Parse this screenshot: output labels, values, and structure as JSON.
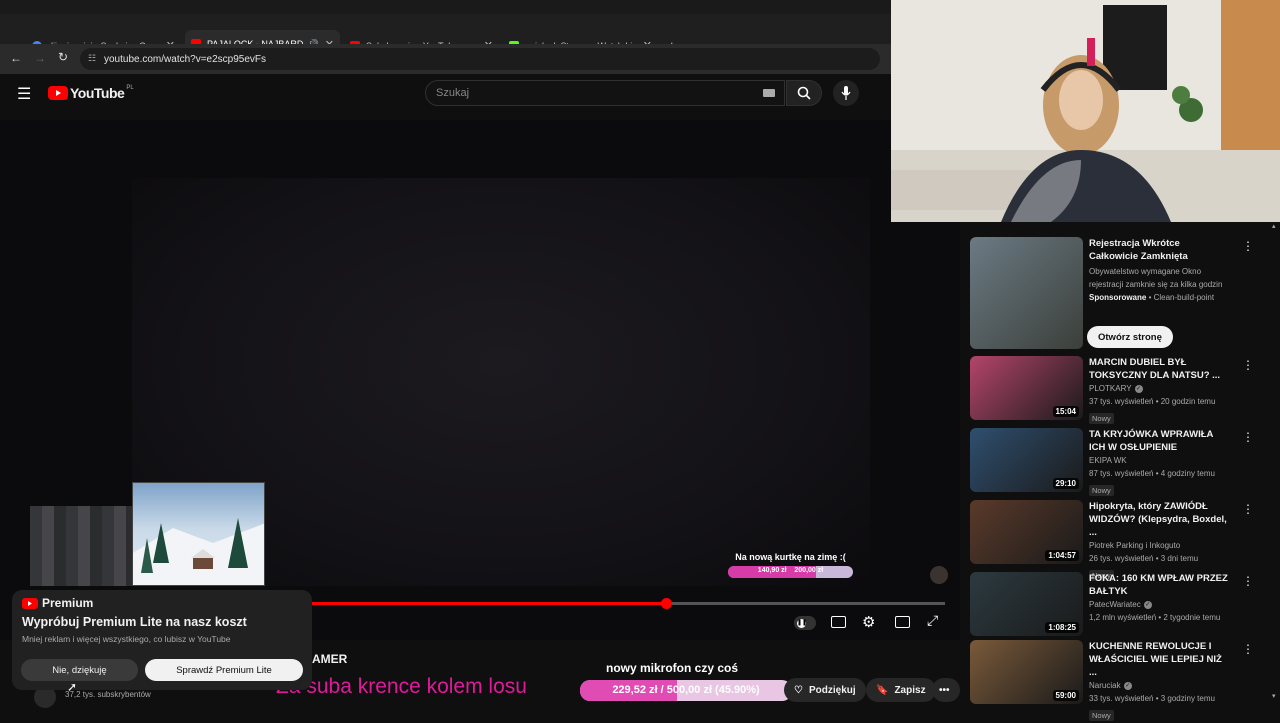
{
  "tabs": [
    {
      "title": "dji mic mini - Szukaj w Google",
      "favicon_color": "#4285f4"
    },
    {
      "title": "PAJALOCK - NAJBARDZIEJ",
      "favicon_color": "#ff0000"
    },
    {
      "title": "Subskrypcje - YouTube",
      "favicon_color": "#ff0000"
    },
    {
      "title": "pajalock Stream - Watch Live on",
      "favicon_color": "#53fc18"
    }
  ],
  "address": {
    "url": "youtube.com/watch?v=e2scp95evFs"
  },
  "header": {
    "logo": "YouTube",
    "region": "PL",
    "search_placeholder": "Szukaj"
  },
  "player": {
    "goal_title": "Na nową kurtkę na zimę :(",
    "goal_current": "140,90 zł",
    "goal_target": "200,00 zł",
    "progress": 0.7
  },
  "premium": {
    "brand": "Premium",
    "title": "Wypróbuj Premium Lite na nasz koszt",
    "body": "Mniej reklam i więcej wszystkiego, co lubisz w YouTube",
    "decline": "Nie, dziękuję",
    "accept": "Sprawdź Premium Lite"
  },
  "below": {
    "title_fragment": "AMER",
    "subscribers": "37,2 tys. subskrybentów",
    "overlay_text": "Za suba krence kolem losu",
    "mic_goal_title": "nowy mikrofon czy coś",
    "mic_goal_text": "229,52 zł / 500,00 zł (45.90%)",
    "mic_goal_progress": 0.459,
    "thanks_label": "Podziękuj",
    "save_label": "Zapisz"
  },
  "recommendations": [
    {
      "title": "Rejestracja Wkrótce Całkowicie Zamknięta",
      "desc": "Obywatelstwo wymagane Okno rejestracji zamknie się za kilka godzin",
      "sponsor": "Sponsorowane",
      "sponsor_channel": "Clean-build-point",
      "cta": "Otwórz stronę",
      "thumb_color": "#6b7a84"
    },
    {
      "title": "MARCIN DUBIEL BYŁ TOKSYCZNY DLA NATSU? ...",
      "channel": "PLOTKARY",
      "meta": "37 tys. wyświetleń • 20 godzin temu",
      "badge": "Nowy",
      "duration": "15:04",
      "thumb_color": "#b4456a"
    },
    {
      "title": "TA KRYJÓWKA WPRAWIŁA ICH W OSŁUPIENIE",
      "channel": "EKIPA WK",
      "meta": "87 tys. wyświetleń • 4 godziny temu",
      "badge": "Nowy",
      "duration": "29:10",
      "thumb_color": "#2f4f6f"
    },
    {
      "title": "Hipokryta, który ZAWIÓDŁ WIDZÓW? (Klepsydra, Boxdel, ...",
      "channel": "Piotrek Parking i Inkoguto",
      "meta": "26 tys. wyświetleń • 3 dni temu",
      "badge": "Nowy",
      "duration": "1:04:57",
      "thumb_color": "#5a3a2a"
    },
    {
      "title": "FOKA: 160 KM WPŁAW PRZEZ BAŁTYK",
      "channel": "PatecWariatec",
      "meta": "1,2 mln wyświetleń • 2 tygodnie temu",
      "duration": "1:08:25",
      "thumb_color": "#2c3a40"
    },
    {
      "title": "KUCHENNE REWOLUCJE I WŁAŚCICIEL WIE LEPIEJ NIŻ ...",
      "channel": "Naruciak",
      "meta": "33 tys. wyświetleń • 3 godziny temu",
      "badge": "Nowy",
      "duration": "59:00",
      "thumb_color": "#7a5a3a"
    }
  ]
}
